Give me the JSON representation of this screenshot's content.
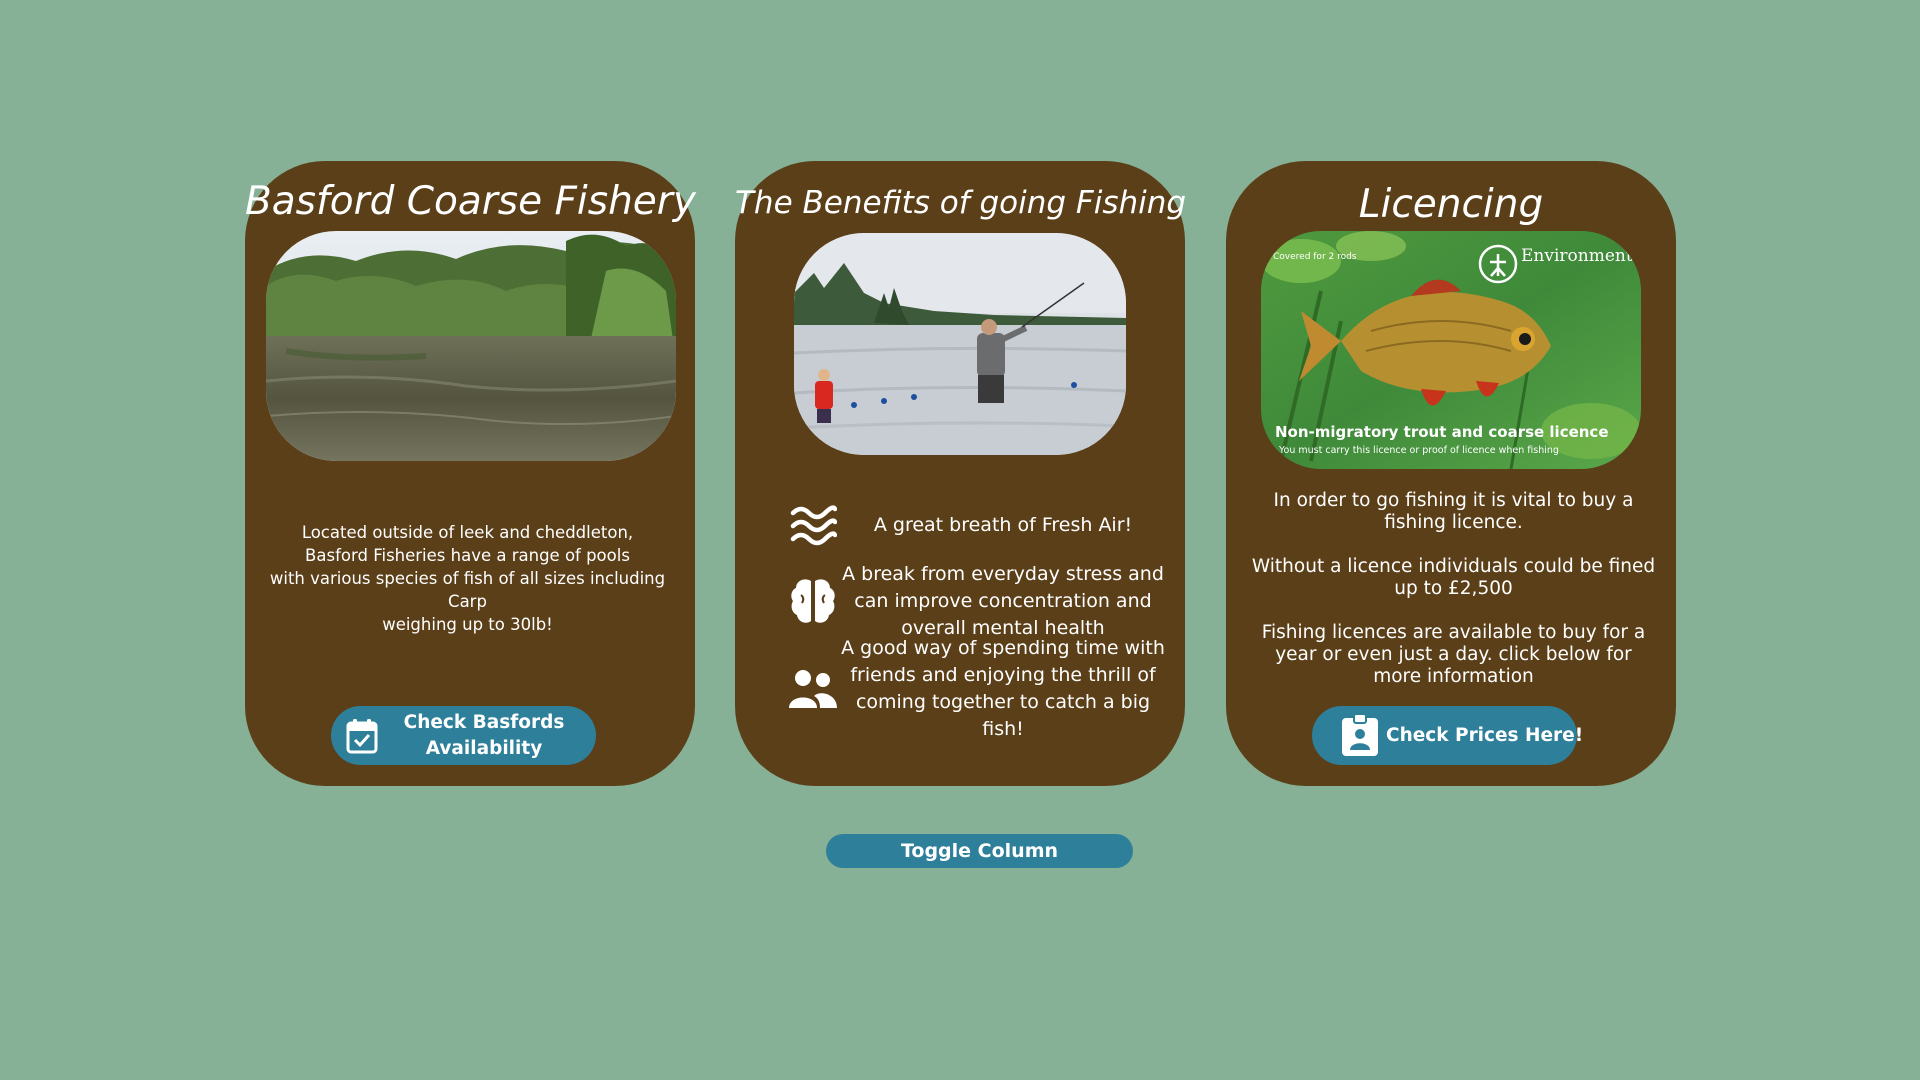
{
  "cards": {
    "basford": {
      "title": "Basford Coarse Fishery",
      "description": [
        "Located outside of leek and cheddleton,",
        "Basford Fisheries have a range of pools",
        "with various species of fish of all sizes including Carp",
        "weighing up to 30lb!"
      ],
      "button_line1": "Check Basfords",
      "button_line2": "Availability"
    },
    "benefits": {
      "title": "The Benefits of going Fishing",
      "items": [
        {
          "icon": "waves-icon",
          "text": "A great breath of Fresh Air!"
        },
        {
          "icon": "brain-icon",
          "text": "A break from everyday stress and can improve concentration and overall mental health"
        },
        {
          "icon": "people-icon",
          "text": "A good way of spending time with friends and enjoying the thrill of coming together to catch a big fish!"
        }
      ]
    },
    "licencing": {
      "title": "Licencing",
      "image_text": {
        "agency": "Environment Agency",
        "covered": "Covered for 2 rods",
        "licence_title": "Non-migratory trout and coarse licence",
        "licence_sub": "You must carry this licence or proof of licence when fishing"
      },
      "paragraphs": [
        "In order to go fishing it is vital to buy a fishing licence.",
        "Without a licence individuals could be fined up to £2,500",
        "Fishing licences are available to buy for a year or even just a day. click below for more information"
      ],
      "button_label": "Check Prices Here!"
    }
  },
  "toggle_label": "Toggle Column",
  "colors": {
    "background": "#86b196",
    "card": "#5b3f19",
    "button": "#2e7f99",
    "text": "#ffffff"
  }
}
